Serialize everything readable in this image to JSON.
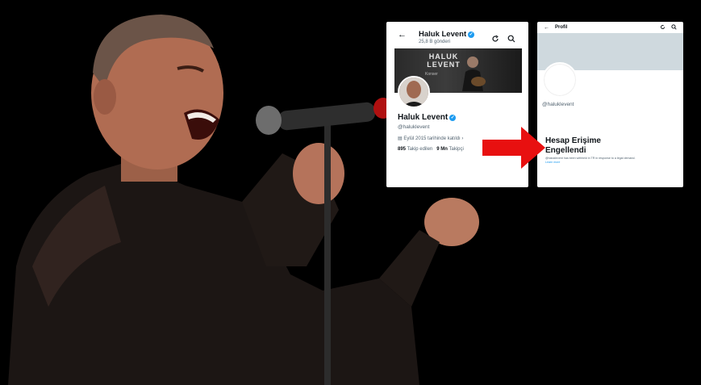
{
  "card1": {
    "header_name": "Haluk Levent",
    "header_sub": "25,8 B gönderi",
    "banner_title": "HALUK LEVENT",
    "banner_sub": "Konser",
    "profile_name": "Haluk Levent",
    "handle": "@haluklevent",
    "joined": "Eylül 2015 tarihinde katıldı",
    "following_count": "895",
    "following_label": "Takip edilen",
    "followers_count": "9 Mn",
    "followers_label": "Takipçi"
  },
  "card2": {
    "header": "Profil",
    "handle": "@haluklevent",
    "blocked_title": "Hesap Erişime Engellendi",
    "note": "@haluklevent has been withheld in TR in response to a legal demand.",
    "learn_more": "Learn more"
  },
  "colors": {
    "verified": "#1d9bf0",
    "arrow": "#e81010"
  }
}
